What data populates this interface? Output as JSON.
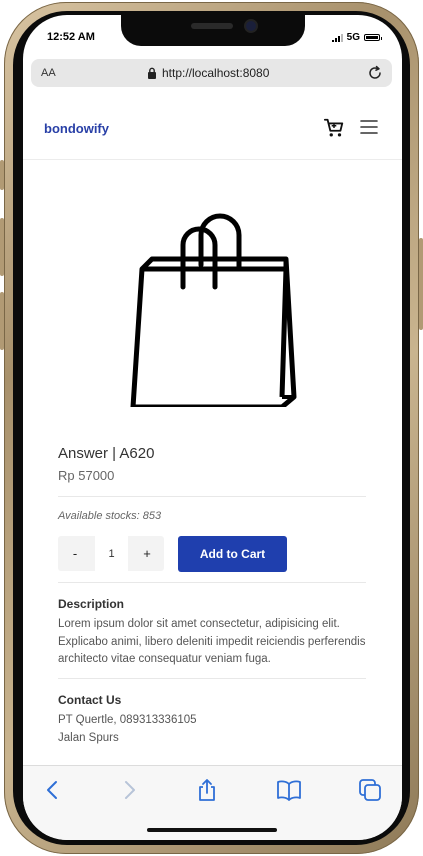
{
  "status_bar": {
    "time": "12:52 AM",
    "network": "5G"
  },
  "browser": {
    "text_size_label": "AA",
    "url": "http://localhost:8080"
  },
  "navbar": {
    "brand": "bondowify"
  },
  "product": {
    "title": "Answer | A620",
    "price": "Rp 57000",
    "stocks": "Available stocks: 853",
    "quantity": "1",
    "minus_label": "-",
    "plus_label": "+",
    "add_to_cart_label": "Add to Cart"
  },
  "description": {
    "title": "Description",
    "text": "Lorem ipsum dolor sit amet consectetur, adipisicing elit. Explicabo animi, libero deleniti impedit reiciendis perferendis architecto vitae consequatur veniam fuga."
  },
  "contact": {
    "title": "Contact Us",
    "line1": "PT Quertle, 089313336105",
    "line2": "Jalan Spurs"
  },
  "colors": {
    "brand": "#2940a7",
    "button": "#1f3fae",
    "safari_icons": "#2f6fd6"
  },
  "icons": [
    "lock-icon",
    "reload-icon",
    "cart-icon",
    "menu-icon",
    "shopping-bag-icon",
    "back-icon",
    "forward-icon",
    "share-icon",
    "bookmarks-icon",
    "tabs-icon"
  ]
}
